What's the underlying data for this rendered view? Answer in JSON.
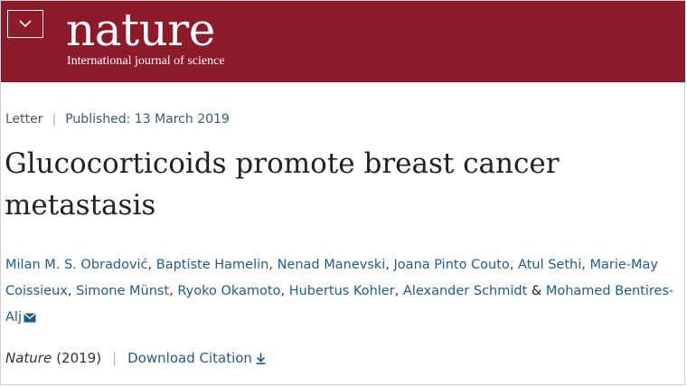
{
  "header": {
    "logo": "nature",
    "tagline": "International journal of science",
    "colors": {
      "brand": "#8d1a2b",
      "text": "#ffffff"
    },
    "menu_icon": "chevron-down-icon"
  },
  "meta": {
    "type": "Letter",
    "published": "Published: 13 March 2019"
  },
  "article": {
    "title": "Glucocorticoids promote breast cancer metastasis"
  },
  "authors": [
    "Milan M. S. Obradović",
    "Baptiste Hamelin",
    "Nenad Manevski",
    "Joana Pinto Couto",
    "Atul Sethi",
    "Marie-May Coissieux",
    "Simone Münst",
    "Ryoko Okamoto",
    "Hubertus Kohler",
    "Alexander Schmidt",
    "Mohamed Bentires-Alj"
  ],
  "author_sep": ",",
  "author_and": "&",
  "corresponding_icon": "mail-icon",
  "citation": {
    "journal": "Nature",
    "year": "(2019)",
    "download_label": "Download Citation",
    "download_icon": "download-icon"
  },
  "colors": {
    "link": "#1f5c8a",
    "title": "#222222"
  }
}
